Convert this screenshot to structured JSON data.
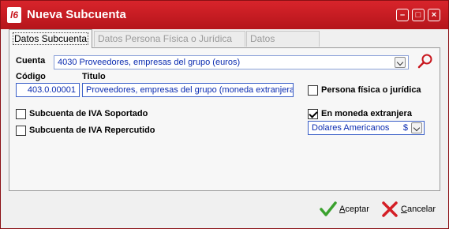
{
  "window": {
    "title": "Nueva Subcuenta",
    "logo_text": "l6",
    "controls": [
      "minimize",
      "maximize",
      "close"
    ]
  },
  "tabs": [
    {
      "label": "Datos Subcuenta",
      "active": true
    },
    {
      "label": "Datos Persona Física o Jurídica",
      "active": false
    },
    {
      "label": "Datos Bancarios",
      "active": false
    }
  ],
  "form": {
    "cuenta_label": "Cuenta",
    "cuenta_value": "4030  Proveedores, empresas del grupo (euros)",
    "codigo_label": "Código",
    "codigo_value": "403.0.00001",
    "titulo_label": "Titulo",
    "titulo_value": "Proveedores, empresas del grupo (moneda extranjera",
    "persona_label": "Persona física o jurídica",
    "persona_checked": false,
    "iva_soportado_label": "Subcuenta de IVA Soportado",
    "iva_soportado_checked": false,
    "iva_repercutido_label": "Subcuenta de IVA Repercutido",
    "iva_repercutido_checked": false,
    "moneda_label": "En moneda extranjera",
    "moneda_checked": true,
    "moneda_value": "Dolares Americanos",
    "moneda_symbol": "$"
  },
  "buttons": {
    "aceptar_first": "A",
    "aceptar_rest": "ceptar",
    "cancelar_first": "C",
    "cancelar_rest": "ancelar"
  },
  "colors": {
    "titlebar": "#c8161d",
    "field_border": "#3a5fc8",
    "field_text": "#0a2bb0",
    "accept_icon": "#3aa12e",
    "cancel_icon": "#d41e25"
  }
}
